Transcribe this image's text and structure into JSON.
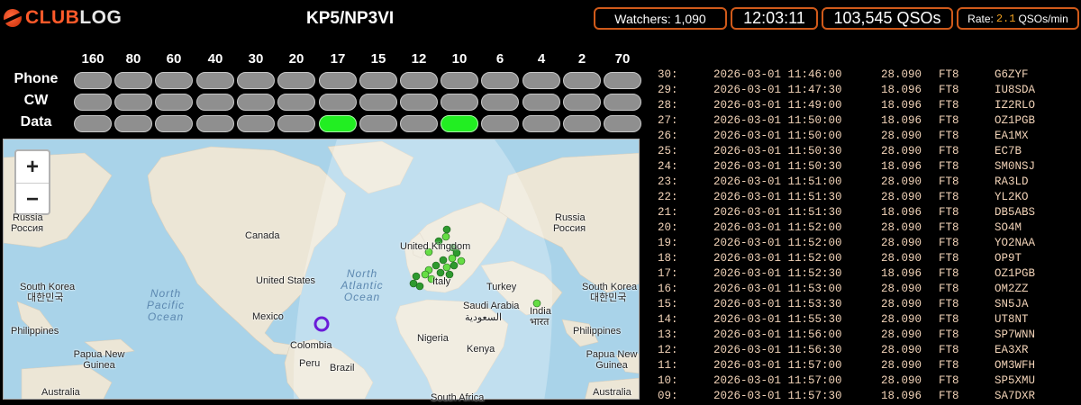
{
  "logo": {
    "part1": "CLUB",
    "part2": "LOG"
  },
  "callsign": "KP5/NP3VI",
  "stats": {
    "watchers": "Watchers: 1,090",
    "clock": "12:03:11",
    "qsos": "103,545 QSOs",
    "rate_label": "Rate:",
    "rate_value": "2.1",
    "rate_unit": "QSOs/min"
  },
  "bands": [
    "160",
    "80",
    "60",
    "40",
    "30",
    "20",
    "17",
    "15",
    "12",
    "10",
    "6",
    "4",
    "2",
    "70"
  ],
  "modes": [
    "Phone",
    "CW",
    "Data"
  ],
  "active": {
    "Data": [
      "17",
      "10"
    ]
  },
  "colors": {
    "accent": "#d05a1a",
    "active": "#22ee22",
    "inactive": "#8f8f8f",
    "log_text": "#f2d3b8"
  },
  "map": {
    "zoom_in": "+",
    "zoom_out": "−",
    "labels": [
      "Russia",
      "Россия",
      "Canada",
      "United Kingdom",
      "Italy",
      "Turkey",
      "Saudi Arabia",
      "السعودية",
      "India",
      "भारत",
      "United States",
      "Mexico",
      "Colombia",
      "Peru",
      "Brazil",
      "Nigeria",
      "Kenya",
      "South Africa",
      "South Korea",
      "대한민국",
      "Philippines",
      "Papua New Guinea",
      "Australia",
      "Russia",
      "Россия",
      "South Korea",
      "대한민국",
      "Philippines",
      "Papua New Guinea",
      "Australia"
    ],
    "oceans": [
      "North Atlantic Ocean",
      "North Pacific Ocean"
    ]
  },
  "log": [
    {
      "n": "30:",
      "time": "2026-03-01 11:46:00",
      "freq": "28.090",
      "mode": "FT8",
      "call": "G6ZYF"
    },
    {
      "n": "29:",
      "time": "2026-03-01 11:47:30",
      "freq": "18.096",
      "mode": "FT8",
      "call": "IU8SDA"
    },
    {
      "n": "28:",
      "time": "2026-03-01 11:49:00",
      "freq": "18.096",
      "mode": "FT8",
      "call": "IZ2RLO"
    },
    {
      "n": "27:",
      "time": "2026-03-01 11:50:00",
      "freq": "18.096",
      "mode": "FT8",
      "call": "OZ1PGB"
    },
    {
      "n": "26:",
      "time": "2026-03-01 11:50:00",
      "freq": "28.090",
      "mode": "FT8",
      "call": "EA1MX"
    },
    {
      "n": "25:",
      "time": "2026-03-01 11:50:30",
      "freq": "28.090",
      "mode": "FT8",
      "call": "EC7B"
    },
    {
      "n": "24:",
      "time": "2026-03-01 11:50:30",
      "freq": "18.096",
      "mode": "FT8",
      "call": "SM0NSJ"
    },
    {
      "n": "23:",
      "time": "2026-03-01 11:51:00",
      "freq": "28.090",
      "mode": "FT8",
      "call": "RA3LD"
    },
    {
      "n": "22:",
      "time": "2026-03-01 11:51:30",
      "freq": "28.090",
      "mode": "FT8",
      "call": "YL2KO"
    },
    {
      "n": "21:",
      "time": "2026-03-01 11:51:30",
      "freq": "18.096",
      "mode": "FT8",
      "call": "DB5ABS"
    },
    {
      "n": "20:",
      "time": "2026-03-01 11:52:00",
      "freq": "28.090",
      "mode": "FT8",
      "call": "SO4M"
    },
    {
      "n": "19:",
      "time": "2026-03-01 11:52:00",
      "freq": "28.090",
      "mode": "FT8",
      "call": "YO2NAA"
    },
    {
      "n": "18:",
      "time": "2026-03-01 11:52:00",
      "freq": "28.090",
      "mode": "FT8",
      "call": "OP9T"
    },
    {
      "n": "17:",
      "time": "2026-03-01 11:52:30",
      "freq": "18.096",
      "mode": "FT8",
      "call": "OZ1PGB"
    },
    {
      "n": "16:",
      "time": "2026-03-01 11:53:00",
      "freq": "28.090",
      "mode": "FT8",
      "call": "OM2ZZ"
    },
    {
      "n": "15:",
      "time": "2026-03-01 11:53:30",
      "freq": "28.090",
      "mode": "FT8",
      "call": "SN5JA"
    },
    {
      "n": "14:",
      "time": "2026-03-01 11:55:30",
      "freq": "28.090",
      "mode": "FT8",
      "call": "UT8NT"
    },
    {
      "n": "13:",
      "time": "2026-03-01 11:56:00",
      "freq": "28.090",
      "mode": "FT8",
      "call": "SP7WNN"
    },
    {
      "n": "12:",
      "time": "2026-03-01 11:56:30",
      "freq": "28.090",
      "mode": "FT8",
      "call": "EA3XR"
    },
    {
      "n": "11:",
      "time": "2026-03-01 11:57:00",
      "freq": "28.090",
      "mode": "FT8",
      "call": "OM3WFH"
    },
    {
      "n": "10:",
      "time": "2026-03-01 11:57:00",
      "freq": "28.090",
      "mode": "FT8",
      "call": "SP5XMU"
    },
    {
      "n": "09:",
      "time": "2026-03-01 11:57:30",
      "freq": "18.096",
      "mode": "FT8",
      "call": "SA7DXR"
    }
  ]
}
